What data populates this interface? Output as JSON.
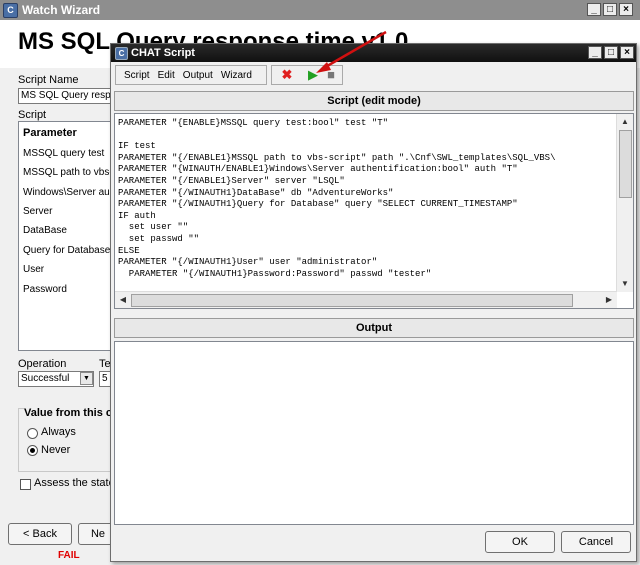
{
  "bg_window": {
    "title": "Watch Wizard",
    "heading": "MS SQL Query response time v1.0",
    "script_name_label": "Script Name",
    "script_name_value": "MS SQL Query respo",
    "script_label": "Script",
    "param_header": "Parameter",
    "params": [
      "MSSQL query test",
      "MSSQL path to vbs-",
      "Windows\\Server au",
      "Server",
      "DataBase",
      "Query for Database",
      "User",
      "Password"
    ],
    "operation_label": "Operation",
    "operation_value": "Successful",
    "te_label": "Te",
    "te_value": "5",
    "value_group_label": "Value from this c",
    "radio_always": "Always",
    "radio_never": "Never",
    "assess_label": "Assess the state c",
    "back_button": "< Back",
    "next_button": "Ne",
    "fail_text": "FAIL",
    "win_controls": [
      "_",
      "□",
      "×"
    ]
  },
  "chat_window": {
    "title": "CHAT Script",
    "win_controls": [
      "_",
      "□",
      "×"
    ],
    "menu": [
      "Script",
      "Edit",
      "Output",
      "Wizard"
    ],
    "tool_glyphs": {
      "stop": "✖",
      "run": "▶",
      "halt": "■"
    },
    "script_header": "Script (edit mode)",
    "script_lines": [
      "PARAMETER \"{ENABLE}MSSQL query test:bool\" test \"T\"",
      "",
      "IF test",
      "PARAMETER \"{/ENABLE1}MSSQL path to vbs-script\" path \".\\Cnf\\SWL_templates\\SQL_VBS\\",
      "PARAMETER \"{WINAUTH/ENABLE1}Windows\\Server authentification:bool\" auth \"T\"",
      "PARAMETER \"{/ENABLE1}Server\" server \"LSQL\"",
      "PARAMETER \"{/WINAUTH1}DataBase\" db \"AdventureWorks\"",
      "PARAMETER \"{/WINAUTH1}Query for Database\" query \"SELECT CURRENT_TIMESTAMP\"",
      "IF auth",
      "  set user \"\"",
      "  set passwd \"\"",
      "ELSE",
      "PARAMETER \"{/WINAUTH1}User\" user \"administrator\"",
      "  PARAMETER \"{/WINAUTH1}Password:Password\" passwd \"tester\""
    ],
    "output_header": "Output",
    "ok_button": "OK",
    "cancel_button": "Cancel",
    "scroll_glyphs": {
      "up": "▲",
      "down": "▼",
      "left": "◀",
      "right": "▶"
    }
  }
}
